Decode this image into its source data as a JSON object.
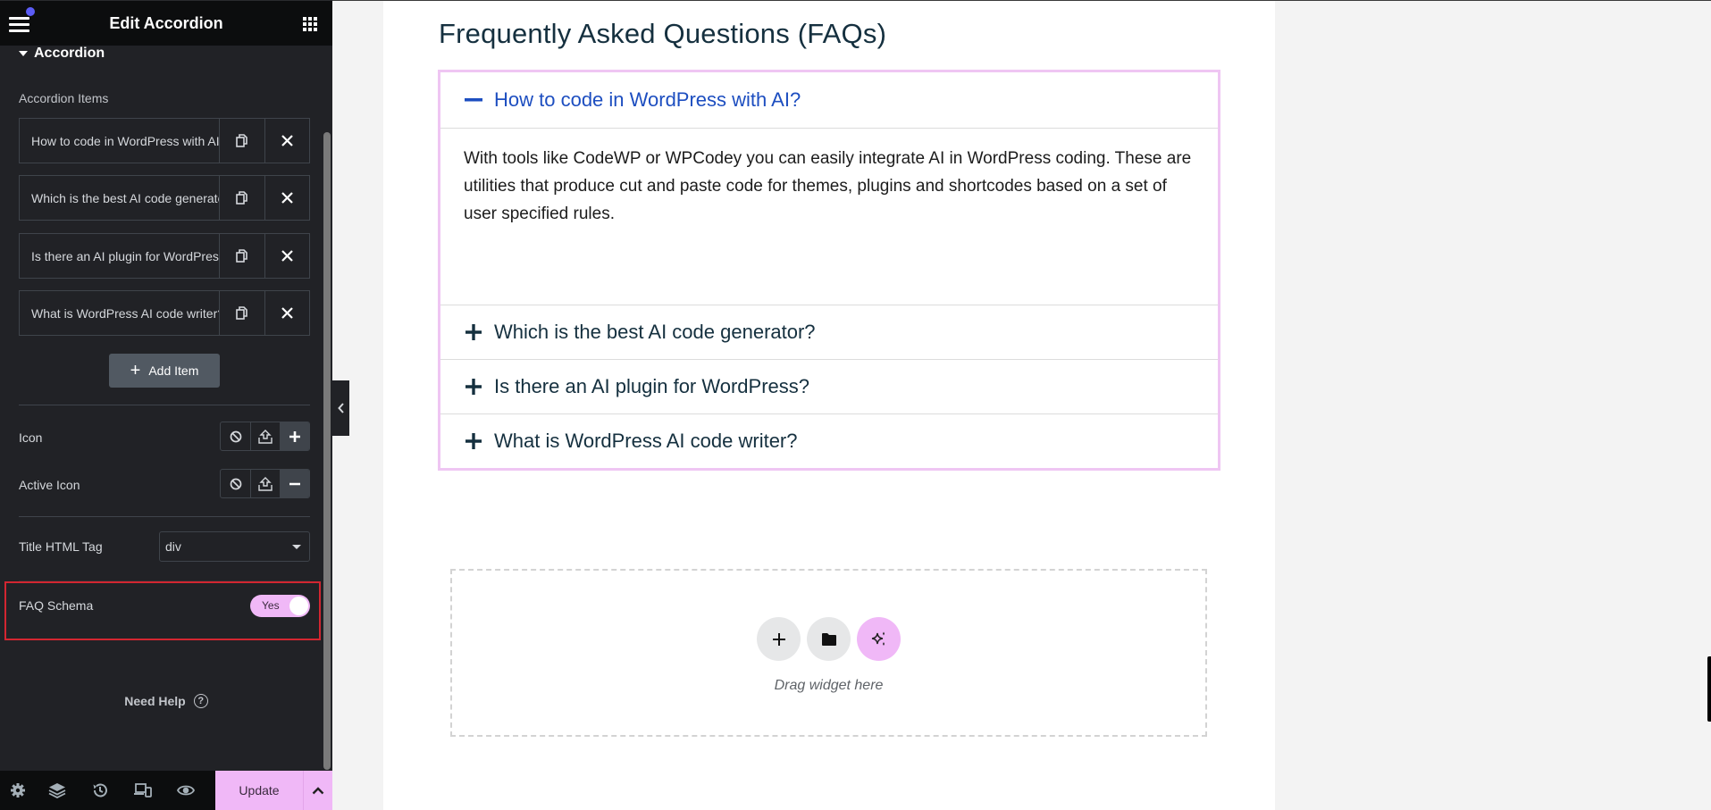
{
  "panel": {
    "title": "Edit Accordion",
    "section_title": "Accordion",
    "items_label": "Accordion Items",
    "items": [
      {
        "title": "How to code in WordPress with AI?"
      },
      {
        "title": "Which is the best AI code generator?"
      },
      {
        "title": "Is there an AI plugin for WordPress?"
      },
      {
        "title": "What is WordPress AI code writer?"
      }
    ],
    "add_item_label": "Add Item",
    "icon_label": "Icon",
    "active_icon_label": "Active Icon",
    "title_tag_label": "Title HTML Tag",
    "title_tag_value": "div",
    "faq_schema_label": "FAQ Schema",
    "faq_schema_toggle": "Yes",
    "need_help_label": "Need Help",
    "footer": {
      "icons": [
        "settings-icon",
        "layers-icon",
        "history-icon",
        "responsive-icon",
        "preview-icon"
      ],
      "update_label": "Update"
    }
  },
  "canvas": {
    "heading": "Frequently Asked Questions (FAQs)",
    "accordion": [
      {
        "title": "How to code in WordPress with AI?",
        "active": true,
        "content": "With tools like CodeWP or WPCodey you can easily integrate AI in WordPress coding. These are utilities that produce cut and paste code for themes, plugins and shortcodes based on a set of user specified rules."
      },
      {
        "title": "Which is the best AI code generator?",
        "active": false
      },
      {
        "title": "Is there an AI plugin for WordPress?",
        "active": false
      },
      {
        "title": "What is WordPress AI code writer?",
        "active": false
      }
    ],
    "dropzone_text": "Drag widget here"
  },
  "colors": {
    "accent_pink": "#f0b8f7",
    "active_title": "#1d4ec0",
    "highlight_red": "#d32631",
    "panel_bg": "#212226"
  }
}
